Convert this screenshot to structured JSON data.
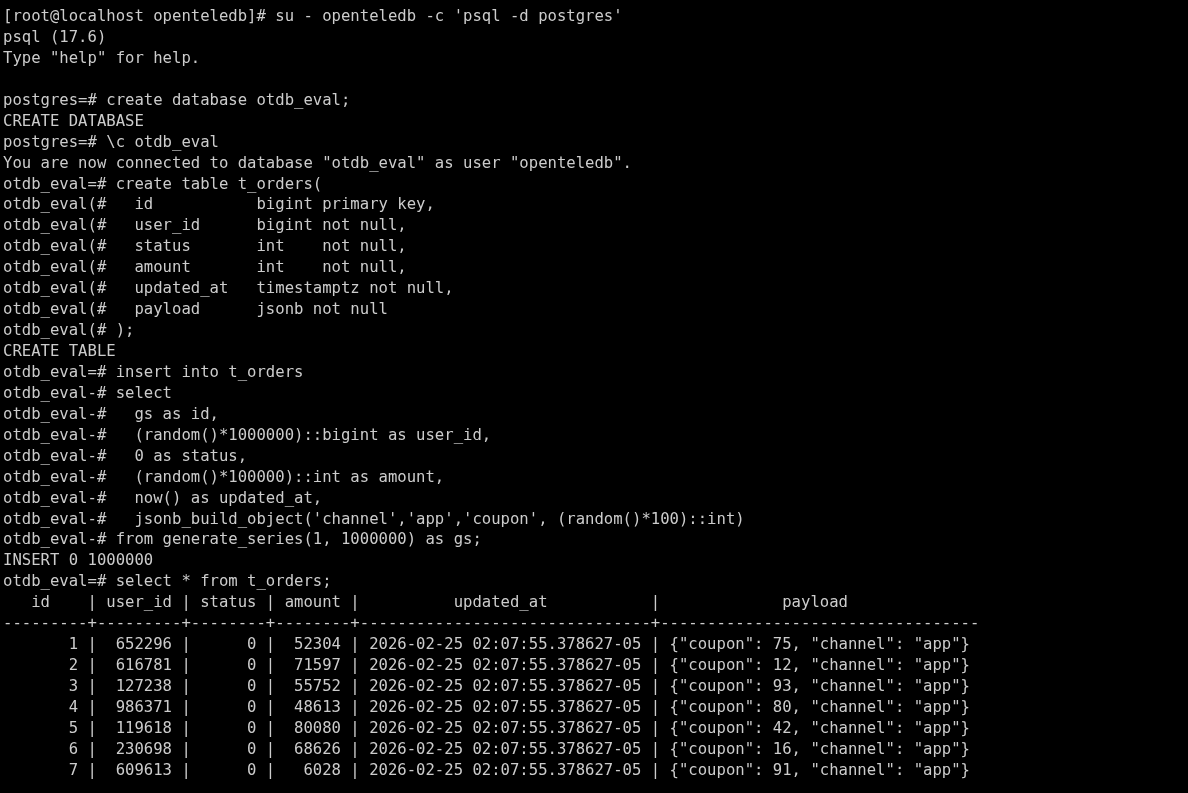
{
  "terminal": {
    "lines": [
      {
        "kind": "text",
        "text": "[root@localhost openteledb]# su - openteledb -c 'psql -d postgres'"
      },
      {
        "kind": "text",
        "text": "psql (17.6)"
      },
      {
        "kind": "text",
        "text": "Type \"help\" for help."
      },
      {
        "kind": "blank"
      },
      {
        "kind": "text",
        "text": "postgres=# create database otdb_eval;"
      },
      {
        "kind": "text",
        "text": "CREATE DATABASE"
      },
      {
        "kind": "text",
        "text": "postgres=# \\c otdb_eval"
      },
      {
        "kind": "text",
        "text": "You are now connected to database \"otdb_eval\" as user \"openteledb\"."
      },
      {
        "kind": "text",
        "text": "otdb_eval=# create table t_orders("
      },
      {
        "kind": "text",
        "text": "otdb_eval(#   id           bigint primary key,"
      },
      {
        "kind": "text",
        "text": "otdb_eval(#   user_id      bigint not null,"
      },
      {
        "kind": "text",
        "text": "otdb_eval(#   status       int    not null,"
      },
      {
        "kind": "text",
        "text": "otdb_eval(#   amount       int    not null,"
      },
      {
        "kind": "text",
        "text": "otdb_eval(#   updated_at   timestamptz not null,"
      },
      {
        "kind": "text",
        "text": "otdb_eval(#   payload      jsonb not null"
      },
      {
        "kind": "text",
        "text": "otdb_eval(# );"
      },
      {
        "kind": "text",
        "text": "CREATE TABLE"
      },
      {
        "kind": "text",
        "text": "otdb_eval=# insert into t_orders"
      },
      {
        "kind": "text",
        "text": "otdb_eval-# select"
      },
      {
        "kind": "text",
        "text": "otdb_eval-#   gs as id,"
      },
      {
        "kind": "text",
        "text": "otdb_eval-#   (random()*1000000)::bigint as user_id,"
      },
      {
        "kind": "text",
        "text": "otdb_eval-#   0 as status,"
      },
      {
        "kind": "text",
        "text": "otdb_eval-#   (random()*100000)::int as amount,"
      },
      {
        "kind": "text",
        "text": "otdb_eval-#   now() as updated_at,"
      },
      {
        "kind": "text",
        "text": "otdb_eval-#   jsonb_build_object('channel','app','coupon', (random()*100)::int)"
      },
      {
        "kind": "text",
        "text": "otdb_eval-# from generate_series(1, 1000000) as gs;"
      },
      {
        "kind": "text",
        "text": "INSERT 0 1000000"
      },
      {
        "kind": "text",
        "text": "otdb_eval=# select * from t_orders;"
      },
      {
        "kind": "text",
        "text": "   id    | user_id | status | amount |          updated_at           |             payload"
      },
      {
        "kind": "text",
        "text": "---------+---------+--------+--------+-------------------------------+----------------------------------"
      },
      {
        "kind": "text",
        "text": "       1 |  652296 |      0 |  52304 | 2026-02-25 02:07:55.378627-05 | {\"coupon\": 75, \"channel\": \"app\"}"
      },
      {
        "kind": "text",
        "text": "       2 |  616781 |      0 |  71597 | 2026-02-25 02:07:55.378627-05 | {\"coupon\": 12, \"channel\": \"app\"}"
      },
      {
        "kind": "text",
        "text": "       3 |  127238 |      0 |  55752 | 2026-02-25 02:07:55.378627-05 | {\"coupon\": 93, \"channel\": \"app\"}"
      },
      {
        "kind": "text",
        "text": "       4 |  986371 |      0 |  48613 | 2026-02-25 02:07:55.378627-05 | {\"coupon\": 80, \"channel\": \"app\"}"
      },
      {
        "kind": "text",
        "text": "       5 |  119618 |      0 |  80080 | 2026-02-25 02:07:55.378627-05 | {\"coupon\": 42, \"channel\": \"app\"}"
      },
      {
        "kind": "text",
        "text": "       6 |  230698 |      0 |  68626 | 2026-02-25 02:07:55.378627-05 | {\"coupon\": 16, \"channel\": \"app\"}"
      },
      {
        "kind": "text",
        "text": "       7 |  609613 |      0 |   6028 | 2026-02-25 02:07:55.378627-05 | {\"coupon\": 91, \"channel\": \"app\"}"
      }
    ]
  }
}
